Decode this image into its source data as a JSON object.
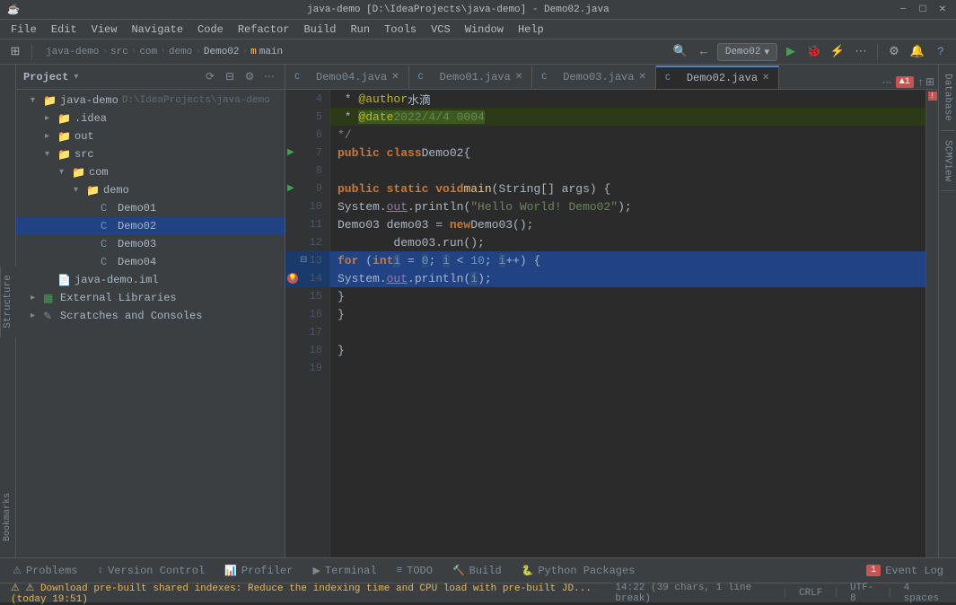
{
  "titlebar": {
    "app_icon": "☕",
    "title": "java-demo [D:\\IdeaProjects\\java-demo] - Demo02.java",
    "minimize": "—",
    "maximize": "☐",
    "close": "✕"
  },
  "menu": {
    "items": [
      "File",
      "Edit",
      "View",
      "Navigate",
      "Code",
      "Refactor",
      "Build",
      "Run",
      "Tools",
      "VCS",
      "Window",
      "Help"
    ]
  },
  "toolbar": {
    "breadcrumb": [
      "java-demo",
      "src",
      "com",
      "demo",
      "Demo02",
      "main"
    ],
    "run_config": "Demo02",
    "icons": [
      "⊞",
      "⚙",
      "🔔"
    ]
  },
  "project_panel": {
    "title": "Project",
    "root": {
      "name": "java-demo",
      "path": "D:\\IdeaProjects\\java-demo"
    },
    "items": [
      {
        "indent": 1,
        "type": "folder",
        "name": ".idea",
        "open": false
      },
      {
        "indent": 1,
        "type": "folder",
        "name": "out",
        "open": false,
        "selected": false
      },
      {
        "indent": 1,
        "type": "folder",
        "name": "src",
        "open": true
      },
      {
        "indent": 2,
        "type": "folder",
        "name": "com",
        "open": true
      },
      {
        "indent": 3,
        "type": "folder",
        "name": "demo",
        "open": true
      },
      {
        "indent": 4,
        "type": "java",
        "name": "Demo01"
      },
      {
        "indent": 4,
        "type": "java",
        "name": "Demo02",
        "selected": true
      },
      {
        "indent": 4,
        "type": "java",
        "name": "Demo03"
      },
      {
        "indent": 4,
        "type": "java",
        "name": "Demo04"
      },
      {
        "indent": 1,
        "type": "iml",
        "name": "java-demo.iml"
      },
      {
        "indent": 0,
        "type": "lib",
        "name": "External Libraries"
      },
      {
        "indent": 0,
        "type": "scratch",
        "name": "Scratches and Consoles"
      }
    ]
  },
  "editor": {
    "tabs": [
      {
        "name": "Demo04.java",
        "active": false,
        "modified": false
      },
      {
        "name": "Demo01.java",
        "active": false,
        "modified": false
      },
      {
        "name": "Demo03.java",
        "active": false,
        "modified": false
      },
      {
        "name": "Demo02.java",
        "active": true,
        "modified": false
      }
    ],
    "lines": [
      {
        "num": 4,
        "content_html": " * <span class='ann'>@author</span> <span class='var'>水滴</span>",
        "gutter": {}
      },
      {
        "num": 5,
        "content_html": " * <span class='ann'>@date</span> <span class='str'>2022/4/4 0004</span>",
        "gutter": {},
        "ann_highlight": true
      },
      {
        "num": 6,
        "content_html": " */",
        "gutter": {}
      },
      {
        "num": 7,
        "content_html": "<span class='kw'>public class</span> <span class='cls'>Demo02</span> {",
        "gutter": {
          "run": true
        },
        "has_run": true
      },
      {
        "num": 8,
        "content_html": "",
        "gutter": {}
      },
      {
        "num": 9,
        "content_html": "    <span class='kw'>public static void</span> <span class='fn'>main</span>(<span class='cls'>String</span>[] args) {",
        "gutter": {
          "run": true
        }
      },
      {
        "num": 10,
        "content_html": "        <span class='cls'>System</span>.<span class='out-var'>out</span>.println(<span class='str'>\"Hello World! Demo02\"</span>);",
        "gutter": {}
      },
      {
        "num": 11,
        "content_html": "        <span class='cls'>Demo03</span> demo03 = <span class='kw'>new</span> <span class='cls'>Demo03</span>();",
        "gutter": {}
      },
      {
        "num": 12,
        "content_html": "        demo03.run();",
        "gutter": {}
      },
      {
        "num": 13,
        "content_html": "        <span class='kw'>for</span> (<span class='kw'>int</span> <span class='highlight-var'>i</span> = <span class='highlight-var'>0</span>; <span class='highlight-var'>i</span> &lt; <span class='num'>10</span>; <span class='highlight-var'>i</span>++) {",
        "gutter": {
          "fold": true
        },
        "selected": true
      },
      {
        "num": 14,
        "content_html": "            <span class='cls'>System</span>.<span class='out-var'>out</span>.println(<span class='highlight-var'>i</span>);",
        "gutter": {
          "hint": true
        },
        "selected": true
      },
      {
        "num": 15,
        "content_html": "        }",
        "gutter": {}
      },
      {
        "num": 16,
        "content_html": "    }",
        "gutter": {}
      },
      {
        "num": 17,
        "content_html": "",
        "gutter": {}
      },
      {
        "num": 18,
        "content_html": "}",
        "gutter": {}
      },
      {
        "num": 19,
        "content_html": "",
        "gutter": {}
      }
    ]
  },
  "right_tabs": [
    "Database",
    "SCMView"
  ],
  "bottom_tabs": [
    {
      "name": "Problems",
      "icon": "⚠"
    },
    {
      "name": "Version Control",
      "icon": "↕"
    },
    {
      "name": "Profiler",
      "icon": "📊",
      "active": false
    },
    {
      "name": "Terminal",
      "icon": "▶"
    },
    {
      "name": "TODO",
      "icon": "≡"
    },
    {
      "name": "Build",
      "icon": "🔨"
    },
    {
      "name": "Python Packages",
      "icon": "🐍"
    }
  ],
  "event_log": {
    "label": "Event Log",
    "count": 1
  },
  "status_bar": {
    "warning": "⚠ Download pre-built shared indexes: Reduce the indexing time and CPU load with pre-built JD... (today 19:51)",
    "position": "14:22 (39 chars, 1 line break)",
    "line_sep": "CRLF",
    "encoding": "UTF-8",
    "indent": "4 spaces"
  }
}
